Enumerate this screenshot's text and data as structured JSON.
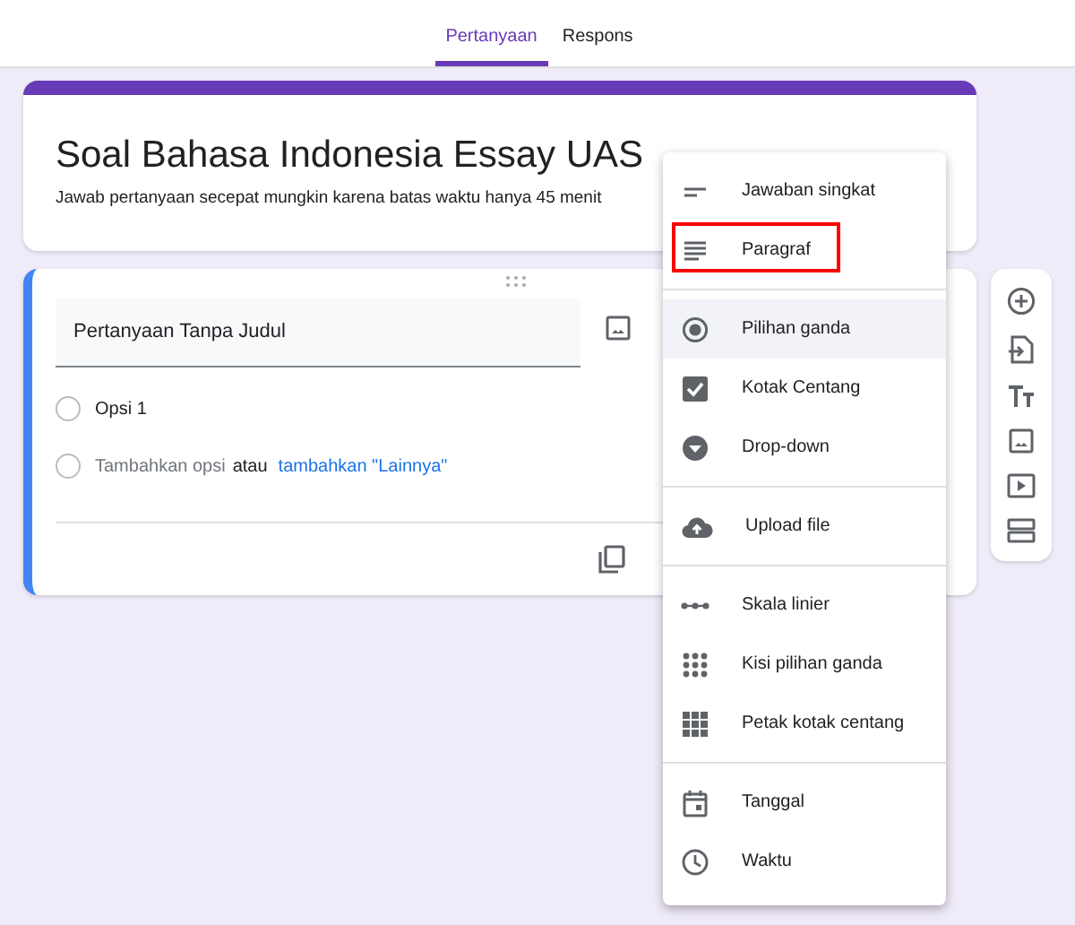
{
  "tabs": [
    {
      "label": "Pertanyaan",
      "selected": true
    },
    {
      "label": "Respons",
      "selected": false
    }
  ],
  "form_header": {
    "title": "Soal Bahasa Indonesia Essay UAS",
    "description": "Jawab pertanyaan secepat mungkin karena batas waktu hanya 45 menit"
  },
  "question": {
    "title": "Pertanyaan Tanpa Judul",
    "options": [
      {
        "label": "Opsi 1",
        "selected": false
      }
    ],
    "add_option": "Tambahkan opsi",
    "add_option_selected": false,
    "or": "atau",
    "add_other": "tambahkan \"Lainnya\""
  },
  "type_menu": {
    "groups": [
      {
        "items": [
          {
            "kind": "short",
            "label": "Jawaban singkat",
            "selected": false,
            "highlighted": false
          },
          {
            "kind": "paragraph",
            "label": "Paragraf",
            "selected": false,
            "highlighted": true
          }
        ]
      },
      {
        "items": [
          {
            "kind": "radio",
            "label": "Pilihan ganda",
            "selected": true,
            "highlighted": false
          },
          {
            "kind": "checkbox",
            "label": "Kotak Centang",
            "selected": false,
            "highlighted": false
          },
          {
            "kind": "dropdown",
            "label": "Drop-down",
            "selected": false,
            "highlighted": false
          }
        ]
      },
      {
        "items": [
          {
            "kind": "upload",
            "label": "Upload file",
            "selected": false,
            "highlighted": false
          }
        ]
      },
      {
        "items": [
          {
            "kind": "scale",
            "label": "Skala linier",
            "selected": false,
            "highlighted": false
          },
          {
            "kind": "grid",
            "label": "Kisi pilihan ganda",
            "selected": false,
            "highlighted": false
          },
          {
            "kind": "checkgrid",
            "label": "Petak kotak centang",
            "selected": false,
            "highlighted": false
          }
        ]
      },
      {
        "items": [
          {
            "kind": "date",
            "label": "Tanggal",
            "selected": false,
            "highlighted": false
          },
          {
            "kind": "time",
            "label": "Waktu",
            "selected": false,
            "highlighted": false
          }
        ]
      }
    ]
  }
}
